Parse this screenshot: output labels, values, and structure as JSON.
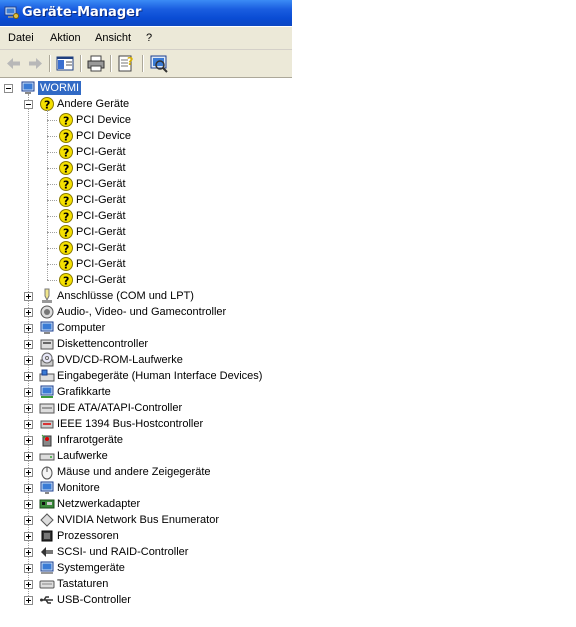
{
  "window": {
    "title": "Geräte-Manager"
  },
  "menu": [
    "Datei",
    "Aktion",
    "Ansicht",
    "?"
  ],
  "toolbar": [
    "back-arrow-icon",
    "forward-arrow-icon",
    "show-hide-console-tree-icon",
    "print-icon",
    "properties-icon",
    "scan-hardware-icon"
  ],
  "tree": {
    "root": "WORMI",
    "other_devices": {
      "label": "Andere Geräte",
      "children": [
        "PCI Device",
        "PCI Device",
        "PCI-Gerät",
        "PCI-Gerät",
        "PCI-Gerät",
        "PCI-Gerät",
        "PCI-Gerät",
        "PCI-Gerät",
        "PCI-Gerät",
        "PCI-Gerät",
        "PCI-Gerät"
      ]
    },
    "categories": [
      {
        "label": "Anschlüsse (COM und LPT)",
        "icon": "port-icon"
      },
      {
        "label": "Audio-, Video- und Gamecontroller",
        "icon": "speaker-icon"
      },
      {
        "label": "Computer",
        "icon": "computer-icon"
      },
      {
        "label": "Diskettencontroller",
        "icon": "floppy-controller-icon"
      },
      {
        "label": "DVD/CD-ROM-Laufwerke",
        "icon": "cdrom-icon"
      },
      {
        "label": "Eingabegeräte (Human Interface Devices)",
        "icon": "hid-icon"
      },
      {
        "label": "Grafikkarte",
        "icon": "display-adapter-icon"
      },
      {
        "label": "IDE ATA/ATAPI-Controller",
        "icon": "ide-controller-icon"
      },
      {
        "label": "IEEE 1394 Bus-Hostcontroller",
        "icon": "firewire-icon"
      },
      {
        "label": "Infrarotgeräte",
        "icon": "infrared-icon"
      },
      {
        "label": "Laufwerke",
        "icon": "disk-drive-icon"
      },
      {
        "label": "Mäuse und andere Zeigegeräte",
        "icon": "mouse-icon"
      },
      {
        "label": "Monitore",
        "icon": "monitor-icon"
      },
      {
        "label": "Netzwerkadapter",
        "icon": "network-adapter-icon"
      },
      {
        "label": "NVIDIA Network Bus Enumerator",
        "icon": "bus-enumerator-icon"
      },
      {
        "label": "Prozessoren",
        "icon": "processor-icon"
      },
      {
        "label": "SCSI- und RAID-Controller",
        "icon": "scsi-icon"
      },
      {
        "label": "Systemgeräte",
        "icon": "system-device-icon"
      },
      {
        "label": "Tastaturen",
        "icon": "keyboard-icon"
      },
      {
        "label": "USB-Controller",
        "icon": "usb-icon"
      }
    ]
  },
  "colors": {
    "title_bar": "#0a4cd4",
    "menu_bg": "#ece9d8",
    "selection": "#316ac5",
    "warning": "#f5e000"
  }
}
